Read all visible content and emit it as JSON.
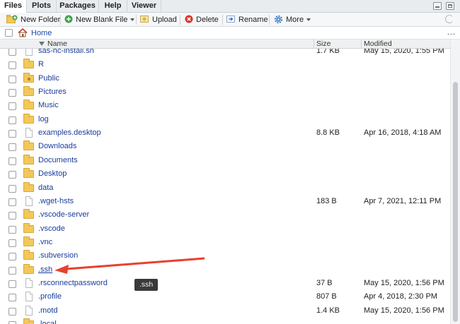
{
  "tabs": [
    {
      "label": "Files",
      "active": true
    },
    {
      "label": "Plots",
      "active": false
    },
    {
      "label": "Packages",
      "active": false
    },
    {
      "label": "Help",
      "active": false
    },
    {
      "label": "Viewer",
      "active": false
    }
  ],
  "toolbar": {
    "new_folder": "New Folder",
    "new_blank_file": "New Blank File",
    "upload": "Upload",
    "delete": "Delete",
    "rename": "Rename",
    "more": "More"
  },
  "path": {
    "home": "Home",
    "more_options": "..."
  },
  "columns": {
    "name": "Name",
    "size": "Size",
    "modified": "Modified"
  },
  "files": [
    {
      "name": "sas-hc-install.sh",
      "type": "file",
      "size": "1.7 KB",
      "modified": "May 15, 2020, 1:55 PM"
    },
    {
      "name": "R",
      "type": "folder",
      "size": "",
      "modified": ""
    },
    {
      "name": "Public",
      "type": "folder-public",
      "size": "",
      "modified": ""
    },
    {
      "name": "Pictures",
      "type": "folder",
      "size": "",
      "modified": ""
    },
    {
      "name": "Music",
      "type": "folder",
      "size": "",
      "modified": ""
    },
    {
      "name": "log",
      "type": "folder",
      "size": "",
      "modified": ""
    },
    {
      "name": "examples.desktop",
      "type": "file",
      "size": "8.8 KB",
      "modified": "Apr 16, 2018, 4:18 AM"
    },
    {
      "name": "Downloads",
      "type": "folder",
      "size": "",
      "modified": ""
    },
    {
      "name": "Documents",
      "type": "folder",
      "size": "",
      "modified": ""
    },
    {
      "name": "Desktop",
      "type": "folder",
      "size": "",
      "modified": ""
    },
    {
      "name": "data",
      "type": "folder",
      "size": "",
      "modified": ""
    },
    {
      "name": ".wget-hsts",
      "type": "file",
      "size": "183 B",
      "modified": "Apr 7, 2021, 12:11 PM"
    },
    {
      "name": ".vscode-server",
      "type": "folder",
      "size": "",
      "modified": ""
    },
    {
      "name": ".vscode",
      "type": "folder",
      "size": "",
      "modified": ""
    },
    {
      "name": ".vnc",
      "type": "folder",
      "size": "",
      "modified": ""
    },
    {
      "name": ".subversion",
      "type": "folder",
      "size": "",
      "modified": ""
    },
    {
      "name": ".ssh",
      "type": "folder",
      "size": "",
      "modified": "",
      "hovered": true
    },
    {
      "name": ".rsconnectpassword",
      "type": "file",
      "size": "37 B",
      "modified": "May 15, 2020, 1:56 PM"
    },
    {
      "name": ".profile",
      "type": "file",
      "size": "807 B",
      "modified": "Apr 4, 2018, 2:30 PM"
    },
    {
      "name": ".motd",
      "type": "file",
      "size": "1.4 KB",
      "modified": "May 15, 2020, 1:56 PM"
    },
    {
      "name": ".local",
      "type": "folder",
      "size": "",
      "modified": ""
    }
  ],
  "tooltip": ".ssh",
  "colors": {
    "link": "#1a3d9c",
    "annotation_arrow": "#e8412c",
    "folder": "#f2c85a"
  }
}
